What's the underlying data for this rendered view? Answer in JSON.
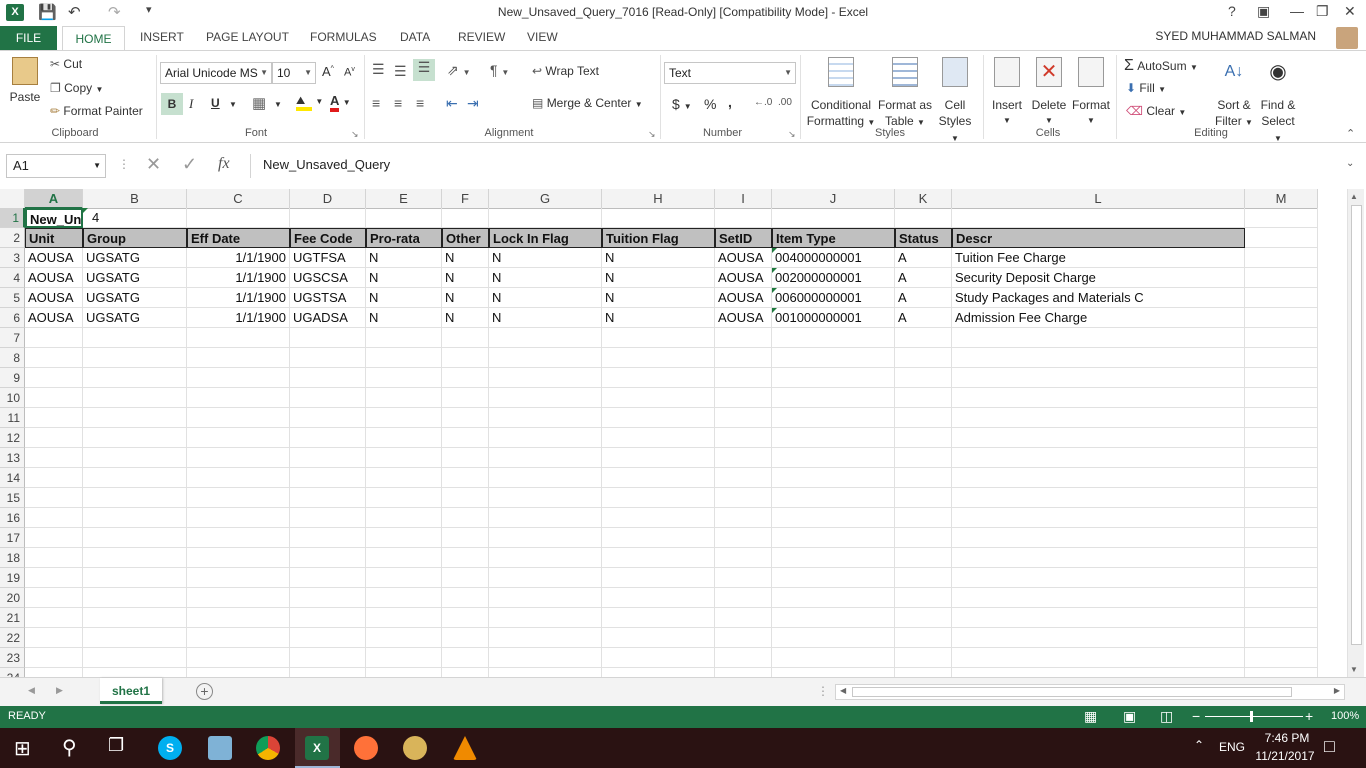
{
  "window": {
    "title": "New_Unsaved_Query_7016  [Read-Only]  [Compatibility Mode] - Excel",
    "logo": "X"
  },
  "user": {
    "name": "SYED MUHAMMAD SALMAN"
  },
  "tabs": {
    "file": "FILE",
    "home": "HOME",
    "insert": "INSERT",
    "page_layout": "PAGE LAYOUT",
    "formulas": "FORMULAS",
    "data": "DATA",
    "review": "REVIEW",
    "view": "VIEW"
  },
  "ribbon": {
    "clipboard": {
      "paste": "Paste",
      "cut": "Cut",
      "copy": "Copy",
      "format_painter": "Format Painter",
      "label": "Clipboard"
    },
    "font": {
      "name": "Arial Unicode MS",
      "size": "10",
      "bold": "B",
      "italic": "I",
      "underline": "U",
      "label": "Font"
    },
    "alignment": {
      "wrap_text": "Wrap Text",
      "merge_center": "Merge & Center",
      "label": "Alignment"
    },
    "number": {
      "format": "Text",
      "currency": "$",
      "percent": "%",
      "comma": ",",
      "label": "Number"
    },
    "styles": {
      "conditional": "Conditional",
      "conditional2": "Formatting",
      "format_table": "Format as",
      "format_table2": "Table",
      "cell_styles": "Cell",
      "cell_styles2": "Styles",
      "label": "Styles"
    },
    "cells": {
      "insert": "Insert",
      "delete": "Delete",
      "format": "Format",
      "label": "Cells"
    },
    "editing": {
      "autosum": "AutoSum",
      "fill": "Fill",
      "clear": "Clear",
      "sort": "Sort &",
      "sort2": "Filter",
      "find": "Find &",
      "find2": "Select",
      "label": "Editing"
    }
  },
  "formula_bar": {
    "name_box": "A1",
    "fx": "fx",
    "content": "New_Unsaved_Query"
  },
  "columns": [
    "A",
    "B",
    "C",
    "D",
    "E",
    "F",
    "G",
    "H",
    "I",
    "J",
    "K",
    "L",
    "M"
  ],
  "rows": [
    "1",
    "2",
    "3",
    "4",
    "5",
    "6",
    "7",
    "8",
    "9",
    "10",
    "11",
    "12",
    "13",
    "14",
    "15",
    "16",
    "17",
    "18",
    "19",
    "20",
    "21",
    "22",
    "23",
    "24"
  ],
  "sheet": {
    "a1": "New_Unsaved_Query",
    "b1": "4",
    "headers": [
      "Unit",
      "Group",
      "Eff Date",
      "Fee Code",
      "Pro-rata",
      "Other",
      "Lock In Flag",
      "Tuition Flag",
      "SetID",
      "Item Type",
      "Status",
      "Descr"
    ],
    "data": [
      [
        "AOUSA",
        "UGSATG",
        "1/1/1900",
        "UGTFSA",
        "N",
        "N",
        "N",
        "N",
        "AOUSA",
        "004000000001",
        "A",
        "Tuition Fee Charge"
      ],
      [
        "AOUSA",
        "UGSATG",
        "1/1/1900",
        "UGSCSA",
        "N",
        "N",
        "N",
        "N",
        "AOUSA",
        "002000000001",
        "A",
        "Security Deposit Charge"
      ],
      [
        "AOUSA",
        "UGSATG",
        "1/1/1900",
        "UGSTSA",
        "N",
        "N",
        "N",
        "N",
        "AOUSA",
        "006000000001",
        "A",
        "Study Packages and Materials C"
      ],
      [
        "AOUSA",
        "UGSATG",
        "1/1/1900",
        "UGADSA",
        "N",
        "N",
        "N",
        "N",
        "AOUSA",
        "001000000001",
        "A",
        "Admission Fee Charge"
      ]
    ]
  },
  "sheet_tab": "sheet1",
  "status": {
    "ready": "READY",
    "zoom": "100%"
  },
  "taskbar": {
    "lang": "ENG",
    "time": "7:46 PM",
    "date": "11/21/2017"
  }
}
